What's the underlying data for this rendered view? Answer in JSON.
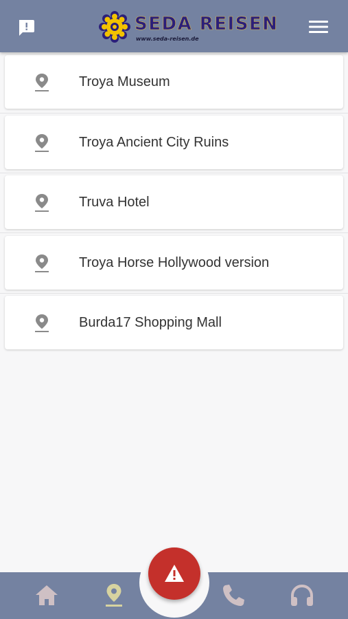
{
  "header": {
    "brand_name": "SEDA REISEN",
    "brand_url": "www.seda-reisen.de",
    "feedback_icon": "feedback-icon",
    "menu_icon": "hamburger-menu-icon",
    "color": "#7482a1"
  },
  "locations": [
    {
      "label": "Troya Museum",
      "icon": "location-pin-icon"
    },
    {
      "label": "Troya Ancient City Ruins",
      "icon": "location-pin-icon"
    },
    {
      "label": "Truva Hotel",
      "icon": "location-pin-icon"
    },
    {
      "label": "Troya Horse Hollywood version",
      "icon": "location-pin-icon"
    },
    {
      "label": "Burda17 Shopping Mall",
      "icon": "location-pin-icon"
    }
  ],
  "bottom_nav": {
    "items": [
      {
        "icon": "home-icon",
        "active": false
      },
      {
        "icon": "location-pin-icon",
        "active": true
      },
      {
        "icon": "phone-icon",
        "active": false
      },
      {
        "icon": "headset-icon",
        "active": false
      }
    ],
    "emergency_icon": "warning-icon",
    "emergency_color": "#c4302b",
    "active_color": "#d7d3a0",
    "inactive_color": "#cfc0c4"
  }
}
